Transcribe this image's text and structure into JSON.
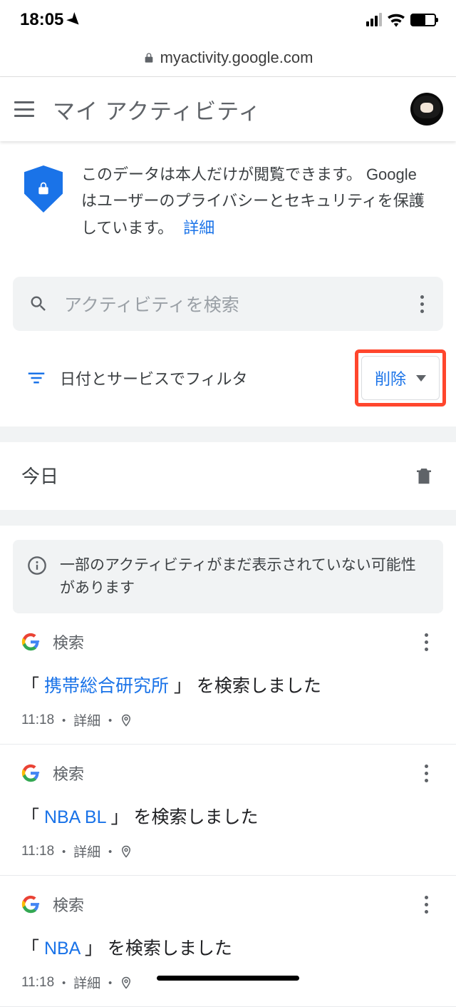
{
  "status": {
    "time": "18:05"
  },
  "url": "myactivity.google.com",
  "header": {
    "title": "マイ アクティビティ"
  },
  "privacy": {
    "line1": "このデータは本人だけが閲覧できます。",
    "line2": "Google はユーザーのプライバシーとセキュリティを保護しています。",
    "link": "詳細"
  },
  "search": {
    "placeholder": "アクティビティを検索"
  },
  "filter": {
    "label": "日付とサービスでフィルタ",
    "delete": "削除"
  },
  "today": {
    "label": "今日"
  },
  "info": {
    "text": "一部のアクティビティがまだ表示されていない可能性があります"
  },
  "items": [
    {
      "service": "検索",
      "prefix": "「 ",
      "query": "携帯総合研究所",
      "suffix": " 」 を検索しました",
      "time": "11:18",
      "details": "詳細"
    },
    {
      "service": "検索",
      "prefix": "「 ",
      "query": "NBA BL",
      "suffix": " 」 を検索しました",
      "time": "11:18",
      "details": "詳細"
    },
    {
      "service": "検索",
      "prefix": "「 ",
      "query": "NBA",
      "suffix": " 」 を検索しました",
      "time": "11:18",
      "details": "詳細"
    }
  ]
}
